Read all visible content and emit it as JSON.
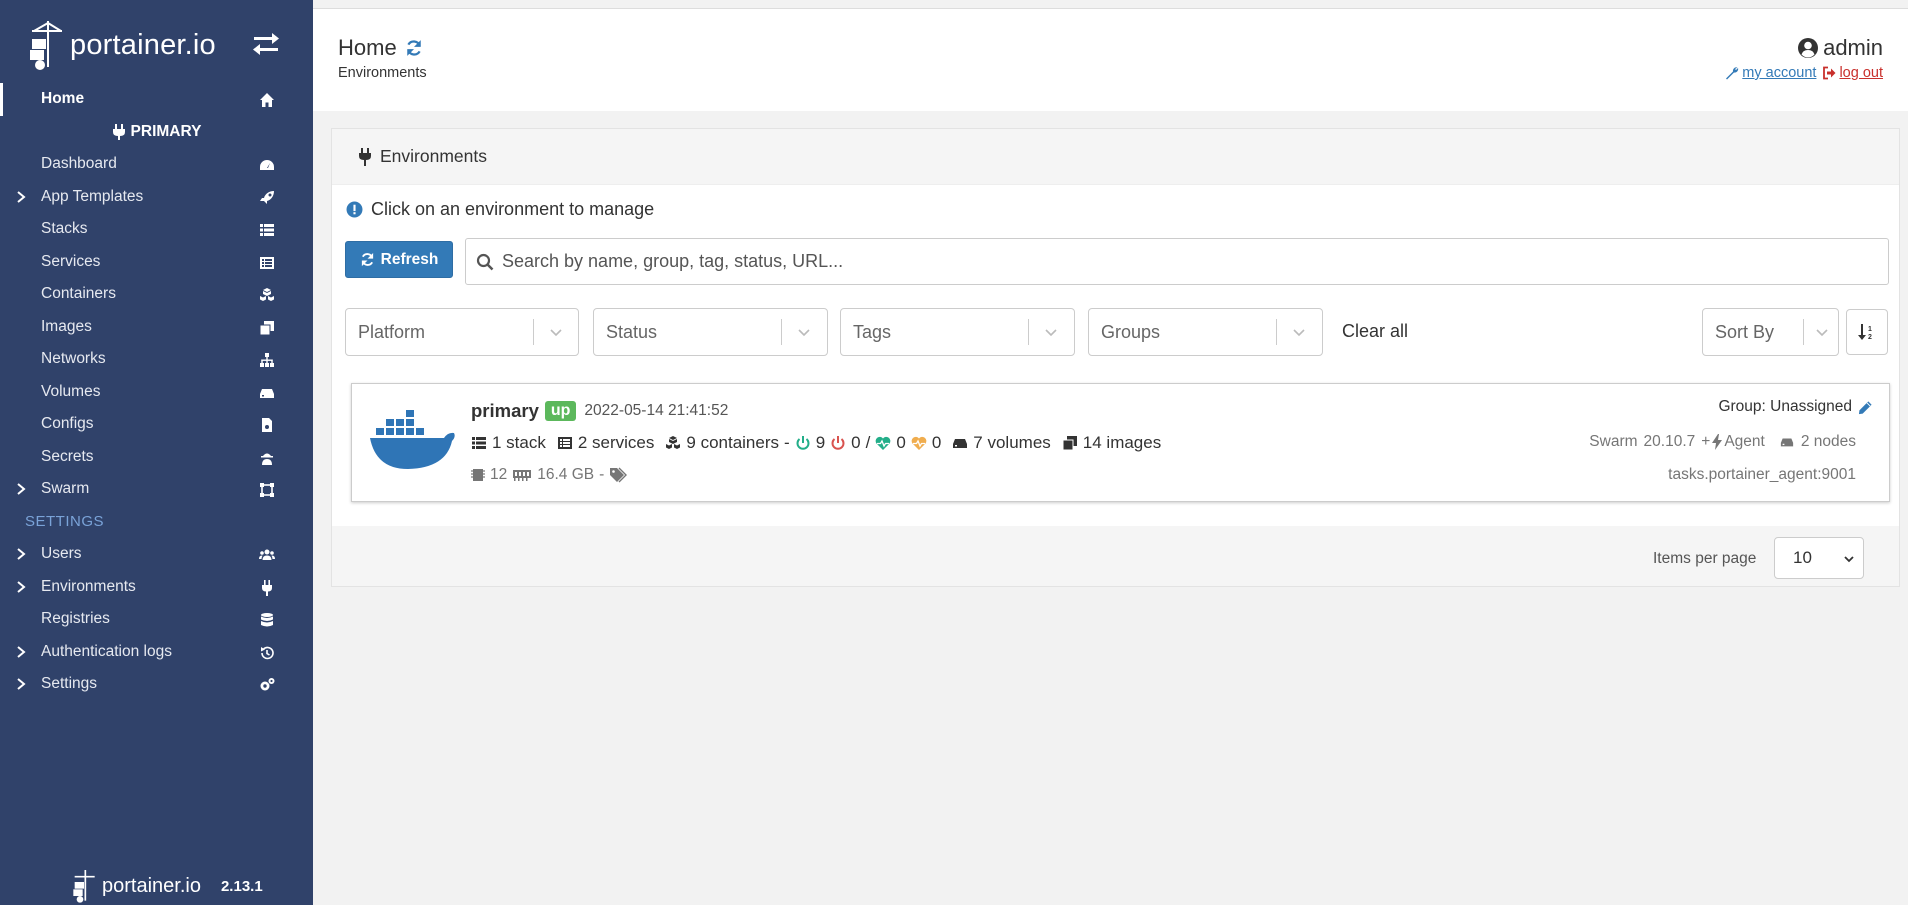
{
  "sidebar": {
    "brand": "portainer.io",
    "home": "Home",
    "environment_name": "PRIMARY",
    "items": [
      {
        "label": "Dashboard",
        "icon": "dashboard-icon",
        "chevron": false
      },
      {
        "label": "App Templates",
        "icon": "rocket-icon",
        "chevron": true
      },
      {
        "label": "Stacks",
        "icon": "stacks-icon",
        "chevron": false
      },
      {
        "label": "Services",
        "icon": "services-icon",
        "chevron": false
      },
      {
        "label": "Containers",
        "icon": "containers-icon",
        "chevron": false
      },
      {
        "label": "Images",
        "icon": "images-icon",
        "chevron": false
      },
      {
        "label": "Networks",
        "icon": "networks-icon",
        "chevron": false
      },
      {
        "label": "Volumes",
        "icon": "volumes-icon",
        "chevron": false
      },
      {
        "label": "Configs",
        "icon": "configs-icon",
        "chevron": false
      },
      {
        "label": "Secrets",
        "icon": "secrets-icon",
        "chevron": false
      },
      {
        "label": "Swarm",
        "icon": "swarm-icon",
        "chevron": true
      }
    ],
    "settings_header": "SETTINGS",
    "settings_items": [
      {
        "label": "Users",
        "icon": "users-icon",
        "chevron": true
      },
      {
        "label": "Environments",
        "icon": "plug-icon",
        "chevron": true
      },
      {
        "label": "Registries",
        "icon": "database-icon",
        "chevron": false
      },
      {
        "label": "Authentication logs",
        "icon": "history-icon",
        "chevron": true
      },
      {
        "label": "Settings",
        "icon": "cogs-icon",
        "chevron": true
      }
    ],
    "footer_brand": "portainer.io",
    "version": "2.13.1"
  },
  "header": {
    "title": "Home",
    "subtitle": "Environments",
    "user": "admin",
    "my_account": "my account",
    "log_out": "log out"
  },
  "widget": {
    "title": "Environments",
    "info": "Click on an environment to manage",
    "refresh_label": "Refresh",
    "search_placeholder": "Search by name, group, tag, status, URL...",
    "filters": {
      "platform": "Platform",
      "status": "Status",
      "tags": "Tags",
      "groups": "Groups",
      "clear_all": "Clear all",
      "sort_by": "Sort By"
    },
    "environment": {
      "name": "primary",
      "status": "up",
      "timestamp": "2022-05-14 21:41:52",
      "stacks": "1 stack",
      "services": "2 services",
      "containers": "9 containers",
      "running": "9",
      "stopped": "0",
      "slash": "/",
      "healthy": "0",
      "unhealthy": "0",
      "volumes": "7 volumes",
      "images": "14 images",
      "cpu": "12",
      "memory": "16.4 GB",
      "dash": "-",
      "group": "Group: Unassigned",
      "swarm": "Swarm",
      "docker_version": "20.10.7",
      "plus": "+",
      "agent": "Agent",
      "nodes": "2 nodes",
      "url": "tasks.portainer_agent:9001"
    },
    "items_per_page_label": "Items per page",
    "items_per_page": "10"
  },
  "colors": {
    "sidebar_bg": "#30426a",
    "primary": "#337ab7",
    "success": "#5cb85c",
    "danger": "#d9534f",
    "section": "#7aa3d8"
  }
}
